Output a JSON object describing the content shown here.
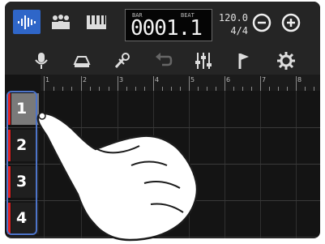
{
  "header": {
    "counter_bar_label": "BAR",
    "counter_beat_label": "BEAT",
    "counter": "0001.1",
    "tempo": "120.0",
    "time_signature": "4/4"
  },
  "toolbar_icons": [
    "mic-icon",
    "mixer-icon",
    "effects-icon",
    "undo-icon",
    "eq-icon",
    "marker-icon",
    "settings-icon"
  ],
  "ruler": {
    "marks": [
      "1",
      "2",
      "3",
      "4",
      "5",
      "6",
      "7",
      "8"
    ]
  },
  "tracks": [
    {
      "number": "1",
      "selected": true
    },
    {
      "number": "2",
      "selected": false
    },
    {
      "number": "3",
      "selected": false
    },
    {
      "number": "4",
      "selected": false
    }
  ],
  "colors": {
    "screen_bg": "#141414",
    "accent_blue": "#2f66c8",
    "track_color": "#e32222",
    "selection_outline": "#4d74c9"
  }
}
